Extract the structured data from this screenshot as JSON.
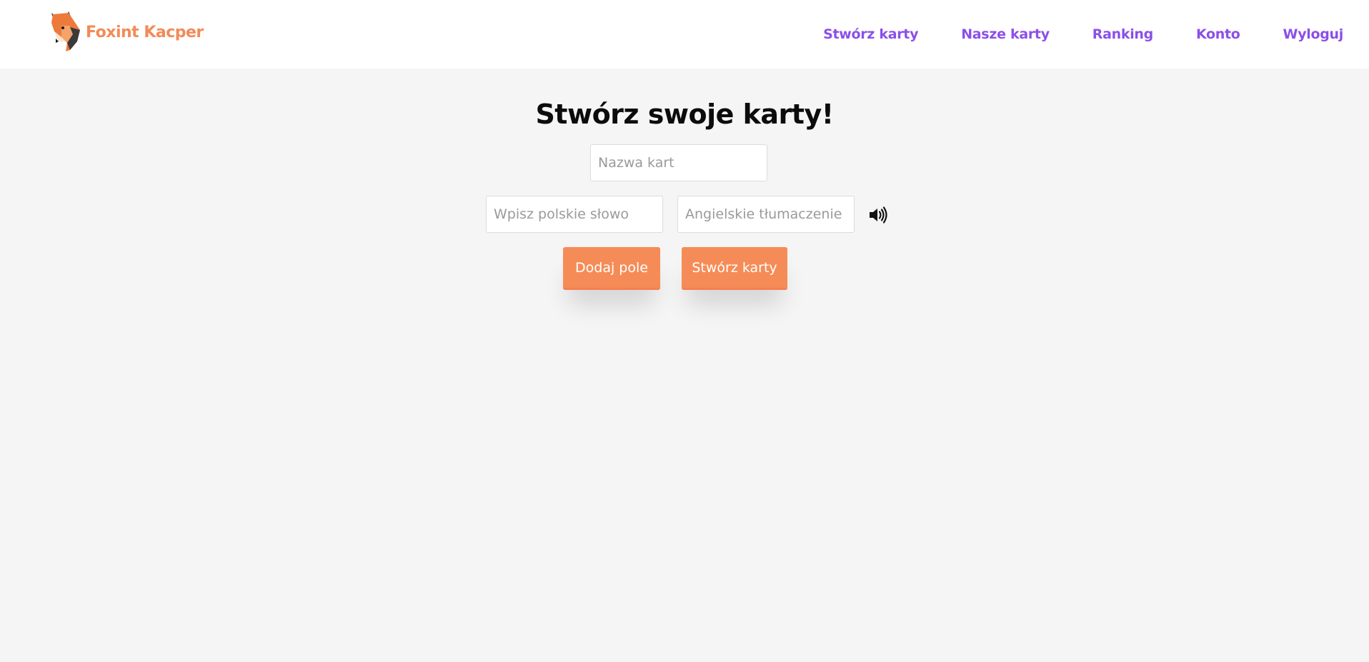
{
  "brand": {
    "name": "Foxint Kacper",
    "logo_icon": "fox-head-icon",
    "color": "#f28b58"
  },
  "nav": {
    "items": [
      {
        "label": "Stwórz karty"
      },
      {
        "label": "Nasze karty"
      },
      {
        "label": "Ranking"
      },
      {
        "label": "Konto"
      },
      {
        "label": "Wyloguj"
      }
    ],
    "color": "#8b4fe9"
  },
  "page": {
    "title": "Stwórz swoje karty!"
  },
  "form": {
    "deck_name": {
      "placeholder": "Nazwa kart",
      "value": ""
    },
    "polish_word": {
      "placeholder": "Wpisz polskie słowo",
      "value": ""
    },
    "english_word": {
      "placeholder": "Angielskie tłumaczenie",
      "value": ""
    },
    "speaker_icon": "speaker-volume-icon",
    "add_field_label": "Dodaj pole",
    "create_cards_label": "Stwórz karty"
  },
  "colors": {
    "background": "#f5f5f5",
    "button": "#f58c57"
  }
}
